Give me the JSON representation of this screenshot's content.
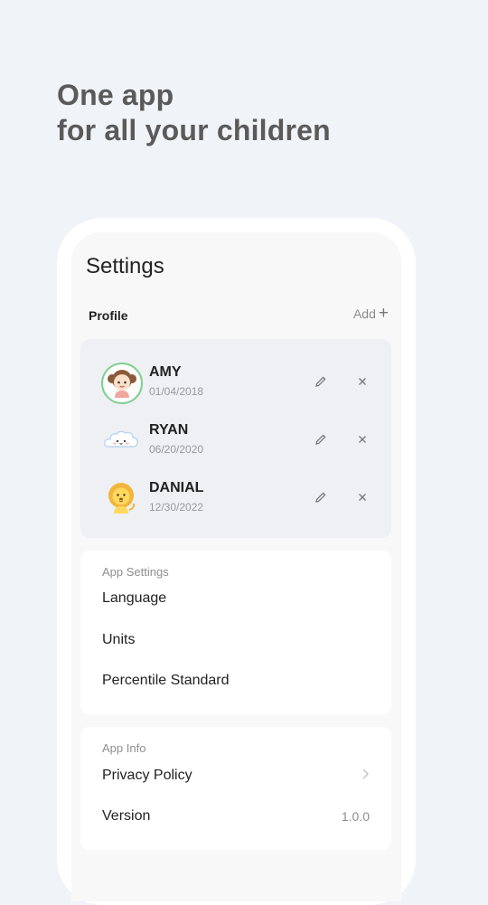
{
  "headline": {
    "line1": "One app",
    "line2": "for all your children"
  },
  "screen": {
    "title": "Settings",
    "profile_label": "Profile",
    "add_label": "Add",
    "add_icon": "+"
  },
  "children": [
    {
      "name": "AMY",
      "dob": "01/04/2018",
      "avatar": "girl-avatar-icon",
      "selected": true
    },
    {
      "name": "RYAN",
      "dob": "06/20/2020",
      "avatar": "cloud-avatar-icon",
      "selected": false
    },
    {
      "name": "DANIAL",
      "dob": "12/30/2022",
      "avatar": "lion-avatar-icon",
      "selected": false
    }
  ],
  "app_settings": {
    "title": "App Settings",
    "items": [
      {
        "label": "Language"
      },
      {
        "label": "Units"
      },
      {
        "label": "Percentile Standard"
      }
    ]
  },
  "app_info": {
    "title": "App Info",
    "items": [
      {
        "label": "Privacy Policy",
        "icon": "chevron-right-icon"
      },
      {
        "label": "Version",
        "value": "1.0.0"
      }
    ]
  },
  "colors": {
    "background": "#f0f3f8",
    "selected_ring": "#7dcf8f",
    "profiles_panel": "#eef0f4"
  }
}
